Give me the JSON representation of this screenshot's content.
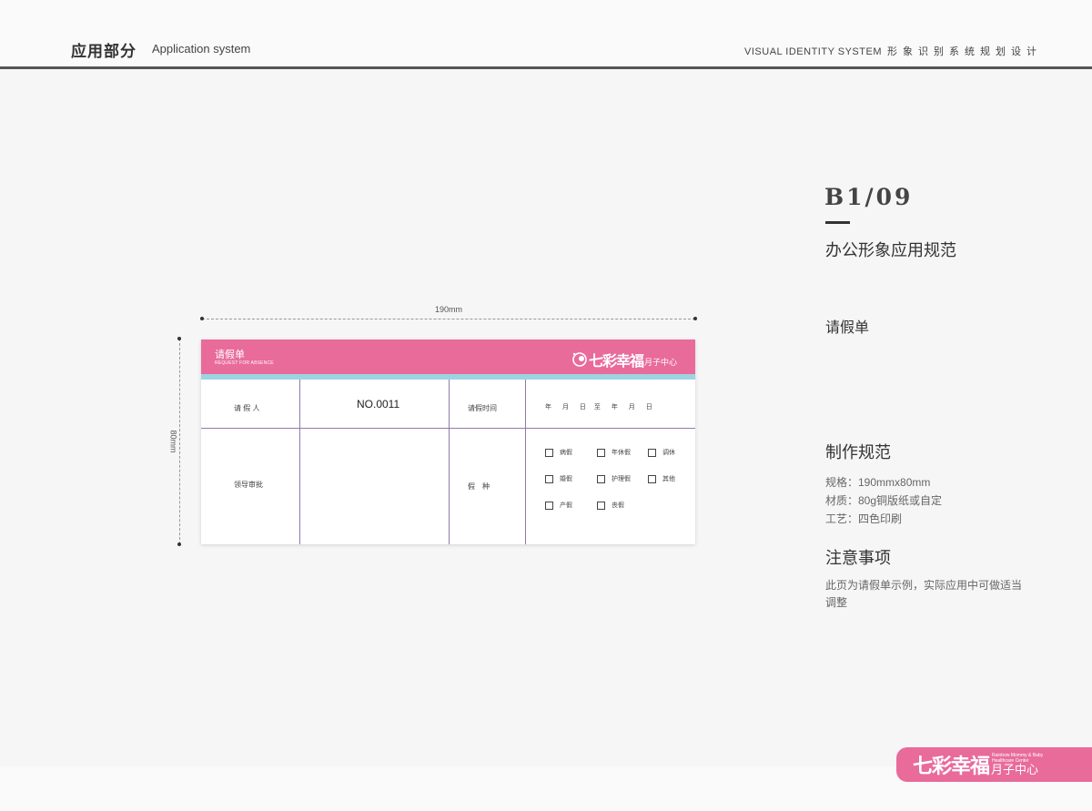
{
  "header": {
    "section_cn": "应用部分",
    "section_en": "Application system",
    "right_en": "VISUAL IDENTITY SYSTEM",
    "right_cn": "形象识别系统规划设计"
  },
  "page": {
    "code": "B1/09",
    "section_title": "办公形象应用规范",
    "item_title": "请假单",
    "spec_title": "制作规范",
    "spec_lines": [
      "规格：190mmx80mm",
      "材质：80g铜版纸或自定",
      "工艺：四色印刷"
    ],
    "note_title": "注意事项",
    "note_text": "此页为请假单示例，实际应用中可做适当调整"
  },
  "dimensions": {
    "width_label": "190mm",
    "height_label": "80mm"
  },
  "form": {
    "title": "请假单",
    "subtitle": "REQUEST FOR ABSENCE",
    "logo_brand": "七彩幸福",
    "logo_sub": "月子中心",
    "applicant_label": "请 假 人",
    "number": "NO.0011",
    "time_label": "请假时间",
    "date_range": "年　 月　 日　至　 年　 月　 日",
    "approval_label": "领导审批",
    "type_label": "假　种",
    "types": [
      "病假",
      "年休假",
      "调休",
      "婚假",
      "护理假",
      "其他",
      "产假",
      "丧假"
    ]
  },
  "footer": {
    "brand": "七彩幸福",
    "sub": "月子中心",
    "tiny": "Rainbow Mommy & Baby Healthcare Center"
  },
  "colors": {
    "brand_pink": "#e86b9a",
    "accent_blue": "#9dd3e3",
    "grid_line": "#8f7aa8"
  }
}
